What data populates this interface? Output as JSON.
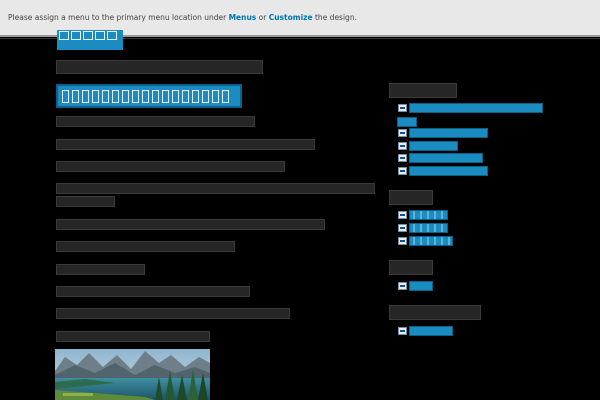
{
  "notice": {
    "prefix": "Please assign a menu to the primary menu location under ",
    "menus_link": "Menus",
    "middle": " or ",
    "customize_link": "Customize",
    "suffix": " the design."
  },
  "colors": {
    "background": "#000000",
    "notice_bg": "#e8e8e8",
    "link_blue": "#0073aa",
    "accent_blue": "#1b8cbf",
    "placeholder_bar": "#262626"
  },
  "content": {
    "thumbnail_alt": "mountain lake landscape"
  }
}
